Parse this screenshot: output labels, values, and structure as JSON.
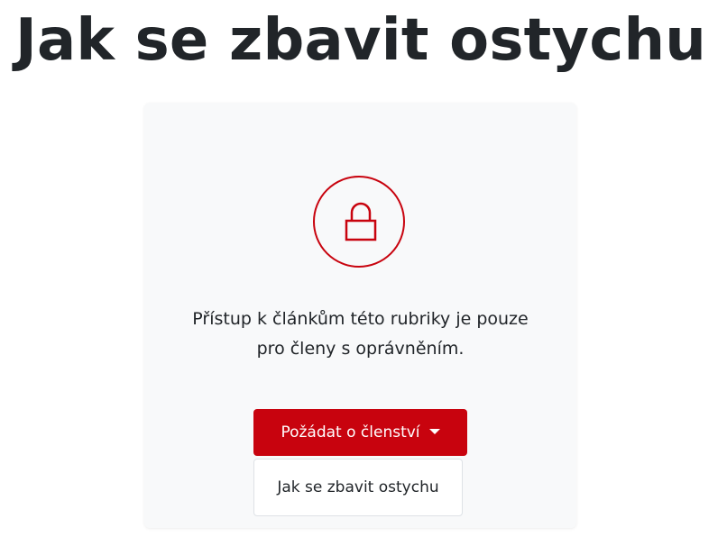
{
  "page": {
    "title": "Jak se zbavit ostychu"
  },
  "access_notice": {
    "icon": "lock-icon",
    "message": "Přístup k článkům této rubriky je pouze pro členy s oprávněním."
  },
  "membership_dropdown": {
    "button_label": "Požádat o členství",
    "caret_icon": "caret-down-icon",
    "expanded": true,
    "items": [
      {
        "label": "Jak se zbavit ostychu"
      }
    ]
  },
  "colors": {
    "accent": "#c8030e",
    "card_background": "#f8f9fa",
    "text": "#212529"
  }
}
